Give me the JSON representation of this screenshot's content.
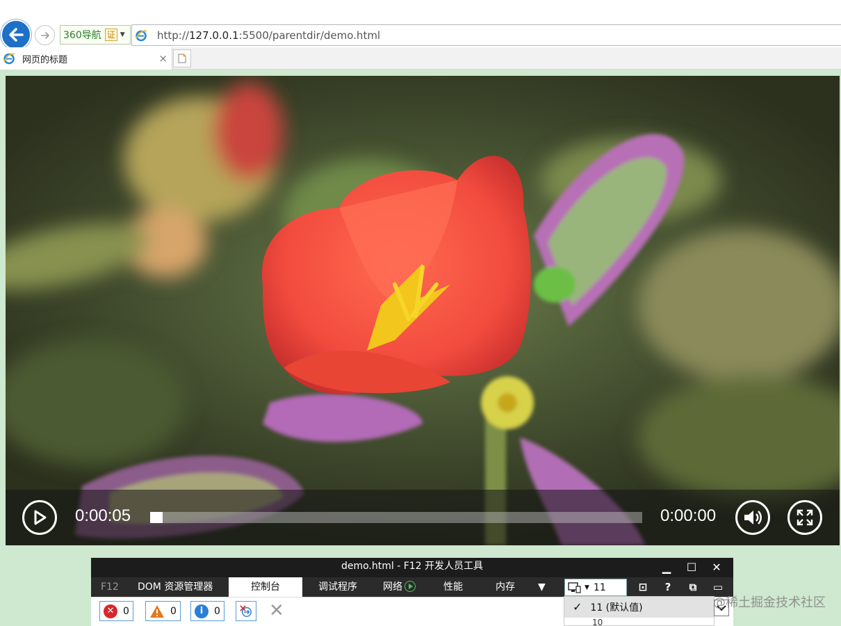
{
  "browser": {
    "search_engine_label": "360导航",
    "cert_label": "证",
    "url": "http://127.0.0.1:5500/parentdir/demo.html",
    "url_prefix": "http://",
    "url_host": "127.0.0.1",
    "url_rest": ":5500/parentdir/demo.html",
    "tab_title": "网页的标题",
    "tab_close": "×"
  },
  "video": {
    "current_time": "0:00:05",
    "duration": "0:00:00",
    "progress_fraction": 0.025
  },
  "devtools": {
    "title": "demo.html - F12 开发人员工具",
    "tabs": [
      {
        "label": "F12"
      },
      {
        "label": "DOM 资源管理器"
      },
      {
        "label": "控制台"
      },
      {
        "label": "调试程序"
      },
      {
        "label": "网络"
      },
      {
        "label": "性能"
      },
      {
        "label": "内存"
      }
    ],
    "document_mode": "11",
    "counters": {
      "errors": "0",
      "warnings": "0",
      "info": "0"
    },
    "dropdown_options": [
      "11 (默认值)",
      "10"
    ]
  },
  "watermark": "@稀土掘金技术社区",
  "colors": {
    "page_background": "#cfe8d0",
    "devtools_titlebar": "#1c1c1c",
    "error_red": "#d9262c",
    "warning_orange": "#e07a1f",
    "info_blue": "#2a7fd4"
  }
}
